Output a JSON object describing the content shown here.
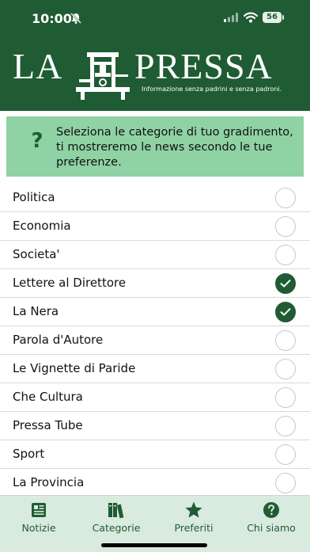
{
  "status_bar": {
    "time": "10:00",
    "battery": "56"
  },
  "brand": {
    "logo_left": "LA",
    "logo_right": "PRESSA",
    "tagline": "Informazione senza padrini e senza padroni."
  },
  "info": {
    "icon": "question-icon",
    "glyph": "?",
    "text": "Seleziona le categorie di tuo gradimento, ti mostreremo le news secondo le tue preferenze."
  },
  "categories": [
    {
      "label": "Politica",
      "selected": false
    },
    {
      "label": "Economia",
      "selected": false
    },
    {
      "label": "Societa'",
      "selected": false
    },
    {
      "label": "Lettere al Direttore",
      "selected": true
    },
    {
      "label": "La Nera",
      "selected": true
    },
    {
      "label": "Parola d'Autore",
      "selected": false
    },
    {
      "label": "Le Vignette di Paride",
      "selected": false
    },
    {
      "label": "Che Cultura",
      "selected": false
    },
    {
      "label": "Pressa Tube",
      "selected": false
    },
    {
      "label": "Sport",
      "selected": false
    },
    {
      "label": "La Provincia",
      "selected": false
    }
  ],
  "tabs": [
    {
      "label": "Notizie",
      "icon": "newspaper-icon"
    },
    {
      "label": "Categorie",
      "icon": "books-icon"
    },
    {
      "label": "Preferiti",
      "icon": "star-icon"
    },
    {
      "label": "Chi siamo",
      "icon": "question-circle-icon"
    }
  ],
  "colors": {
    "brand_green": "#1f5c33",
    "info_bg": "#8fd2a4",
    "tabbar_bg": "#d9eadf"
  }
}
